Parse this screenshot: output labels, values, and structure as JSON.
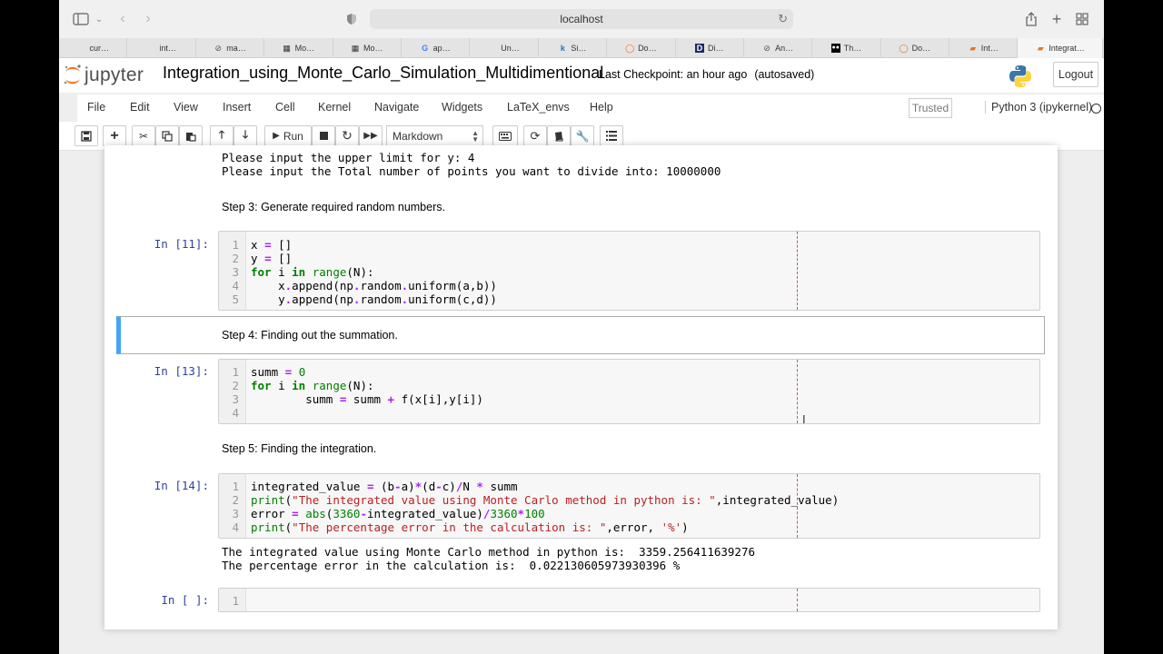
{
  "browser": {
    "address": "localhost",
    "tabs": [
      {
        "label": "cur…",
        "icon": "blank-page-icon"
      },
      {
        "label": "int…",
        "icon": "blank-page-icon"
      },
      {
        "label": "ma…",
        "icon": "compass-icon"
      },
      {
        "label": "Mo…",
        "icon": "grid-icon"
      },
      {
        "label": "Mo…",
        "icon": "grid-icon"
      },
      {
        "label": "ap…",
        "icon": "google-icon"
      },
      {
        "label": "Un…",
        "icon": "blank-page-icon"
      },
      {
        "label": "Si…",
        "icon": "k-icon"
      },
      {
        "label": "Do…",
        "icon": "circle-icon"
      },
      {
        "label": "Di…",
        "icon": "d-icon"
      },
      {
        "label": "An…",
        "icon": "compass-icon"
      },
      {
        "label": "Th…",
        "icon": "medium-icon"
      },
      {
        "label": "Do…",
        "icon": "circle-icon"
      },
      {
        "label": "Int…",
        "icon": "book-icon"
      },
      {
        "label": "Integrat…",
        "icon": "book-icon"
      }
    ]
  },
  "header": {
    "logo_text": "jupyter",
    "title": "Integration_using_Monte_Carlo_Simulation_Multidimentional",
    "checkpoint": "Last Checkpoint: an hour ago",
    "autosave": "(autosaved)",
    "logout": "Logout"
  },
  "menu": {
    "items": [
      "File",
      "Edit",
      "View",
      "Insert",
      "Cell",
      "Kernel",
      "Navigate",
      "Widgets",
      "LaTeX_envs",
      "Help"
    ],
    "trusted": "Trusted",
    "kernel": "Python 3 (ipykernel)"
  },
  "toolbar": {
    "run_label": "Run",
    "cell_type": "Markdown"
  },
  "notebook": {
    "output_top": [
      "Please input the upper limit for y: 4",
      "Please input the Total number of points you want to divide into: 10000000"
    ],
    "md_step3": "Step 3: Generate required random numbers.",
    "cell11": {
      "prompt": "In [11]:",
      "lines": [
        "x = []",
        "y = []",
        "for i in range(N):",
        "    x.append(np.random.uniform(a,b))",
        "    y.append(np.random.uniform(c,d))"
      ]
    },
    "md_step4": "Step 4: Finding out the summation.",
    "cell13": {
      "prompt": "In [13]:",
      "lines": [
        "summ = 0",
        "for i in range(N):",
        "        summ = summ + f(x[i],y[i])",
        ""
      ]
    },
    "md_step5": "Step 5: Finding the integration.",
    "cell14": {
      "prompt": "In [14]:",
      "lines": [
        "integrated_value = (b-a)*(d-c)/N * summ",
        "print(\"The integrated value using Monte Carlo method in python is: \",integrated_value)",
        "error = abs(3360-integrated_value)/3360*100",
        "print(\"The percentage error in the calculation is: \",error, '%')"
      ],
      "output": [
        "The integrated value using Monte Carlo method in python is:  3359.256411639276",
        "The percentage error in the calculation is:  0.022130605973930396 %"
      ]
    },
    "cell_empty": {
      "prompt": "In [ ]:",
      "line_number": "1"
    }
  }
}
